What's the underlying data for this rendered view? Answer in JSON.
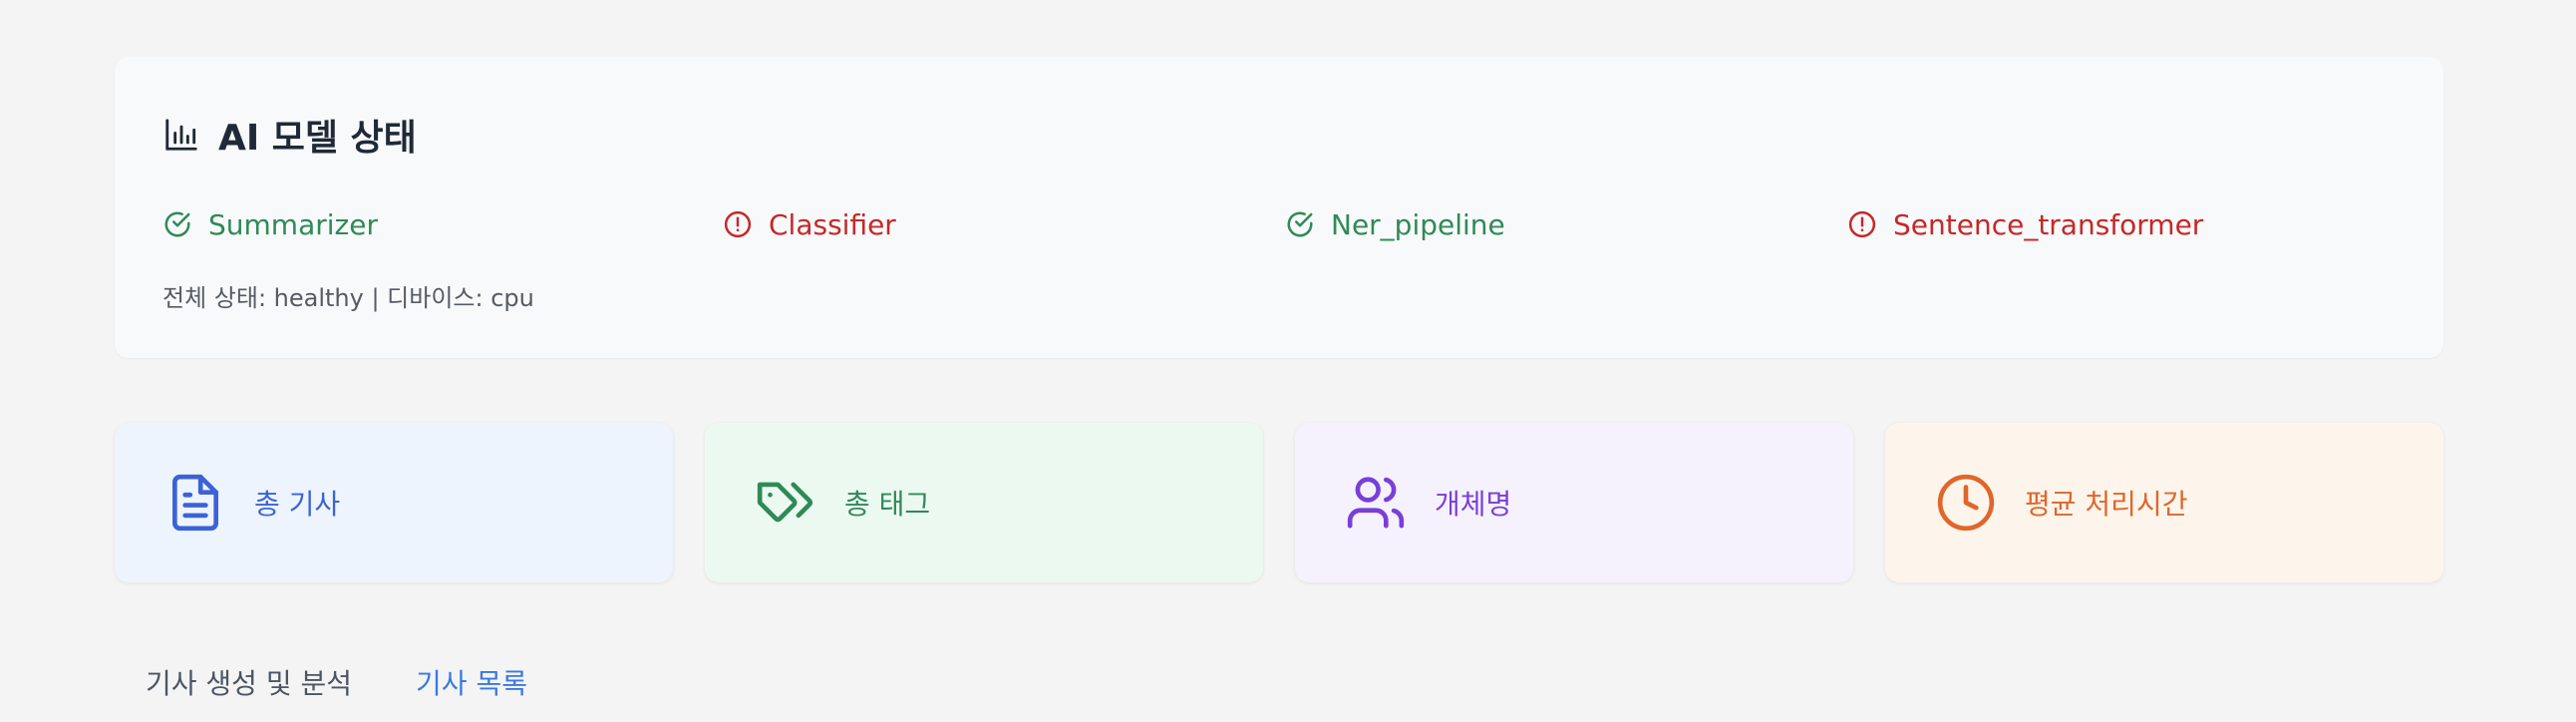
{
  "status_panel": {
    "title": "AI 모델 상태",
    "title_icon": "bar-chart-icon",
    "models": [
      {
        "name": "Summarizer",
        "status": "ok",
        "icon": "check-circle-icon"
      },
      {
        "name": "Classifier",
        "status": "error",
        "icon": "alert-circle-icon"
      },
      {
        "name": "Ner_pipeline",
        "status": "ok",
        "icon": "check-circle-icon"
      },
      {
        "name": "Sentence_transformer",
        "status": "error",
        "icon": "alert-circle-icon"
      }
    ],
    "overall_text": "전체 상태: healthy | 디바이스: cpu",
    "colors": {
      "ok": "#2f8a57",
      "error": "#c62828"
    }
  },
  "stats": [
    {
      "label": "총 기사",
      "icon": "document-icon",
      "color": "#3b63d6",
      "bg": "#eef4fd"
    },
    {
      "label": "총 태그",
      "icon": "tags-icon",
      "color": "#2f8a57",
      "bg": "#ecf9f1"
    },
    {
      "label": "개체명",
      "icon": "users-icon",
      "color": "#7a3fd6",
      "bg": "#f5f2fd"
    },
    {
      "label": "평균 처리시간",
      "icon": "clock-icon",
      "color": "#e0662a",
      "bg": "#fdf5ec"
    }
  ],
  "tabs": [
    {
      "label": "기사 생성 및 분석",
      "active": false
    },
    {
      "label": "기사 목록",
      "active": true
    }
  ]
}
